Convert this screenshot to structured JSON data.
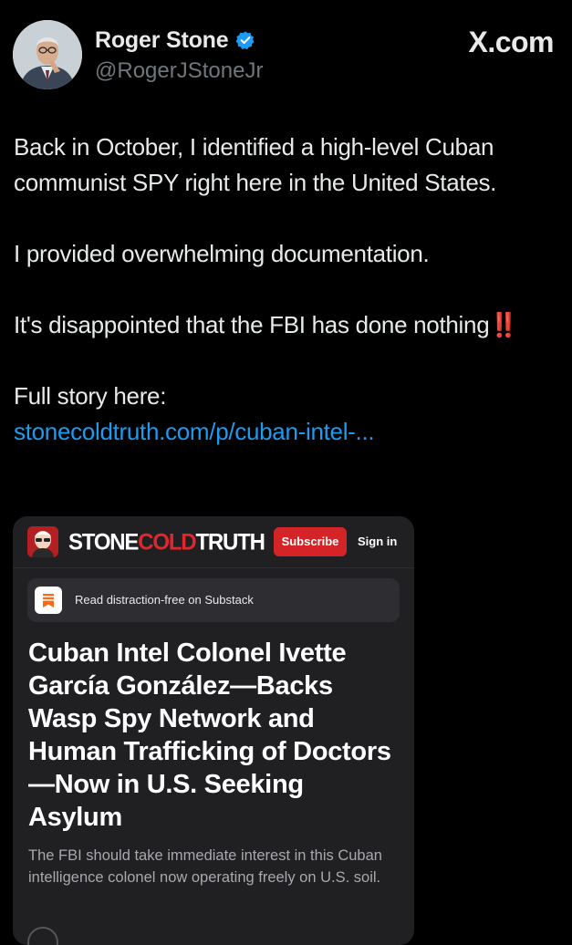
{
  "header": {
    "display_name": "Roger Stone",
    "handle": "@RogerJStoneJr",
    "site_label": "X.com",
    "verified_color": "#1d9bf0"
  },
  "tweet": {
    "line1": "Back in October, I identified a high-level Cuban communist SPY right here in the United States.",
    "line2": "I provided overwhelming documentation.",
    "line3": "It's disappointed that the FBI has done nothing",
    "line3_emoji": "‼️",
    "line4": "Full story here:",
    "link": "stonecoldtruth.com/p/cuban-intel-..."
  },
  "card": {
    "brand_stone": "STONE",
    "brand_cold": "COLD",
    "brand_truth": "TRUTH",
    "subscribe_label": "Subscribe",
    "signin_label": "Sign in",
    "substack_banner": "Read distraction-free on Substack",
    "article_title": "Cuban Intel Colonel Ivette García González—Backs Wasp Spy Network and Human Trafficking of Doctors—Now in U.S. Seeking Asylum",
    "article_subtitle": "The FBI should take immediate interest in this Cuban intelligence colonel now operating freely on U.S. soil."
  },
  "colors": {
    "background": "#000000",
    "link": "#1d9bf0",
    "brand_red": "#d42427",
    "card_bg": "#202023"
  }
}
